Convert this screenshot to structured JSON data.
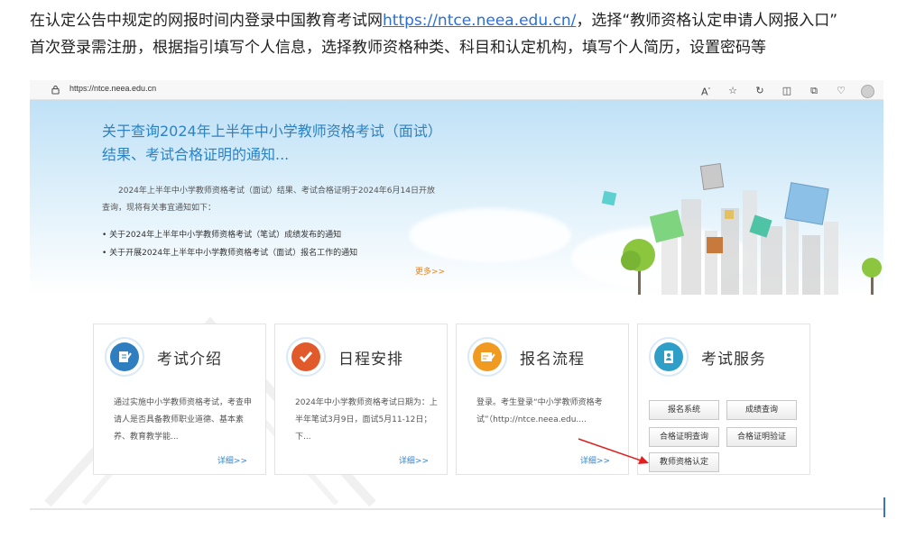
{
  "intro": {
    "line1_before": "在认定公告中规定的网报时间内登录中国教育考试网",
    "link": "https://ntce.neea.edu.cn/",
    "line1_after": "，选择“教师资格认定申请人网报入口”",
    "line2": "首次登录需注册，根据指引填写个人信息，选择教师资格种类、科目和认定机构，填写个人简历，设置密码等"
  },
  "browser": {
    "url": "https://ntce.neea.edu.cn",
    "icons": [
      "read-aloud-icon",
      "favorite-star-icon",
      "refresh-icon",
      "split-screen-icon",
      "collections-icon",
      "extensions-icon",
      "profile-avatar-icon"
    ]
  },
  "banner": {
    "news_title": "关于查询2024年上半年中小学教师资格考试（面试）结果、考试合格证明的通知...",
    "news_desc": "2024年上半年中小学教师资格考试（面试）结果、考试合格证明于2024年6月14日开放查询，现将有关事宜通知如下：",
    "news_items": [
      "关于2024年上半年中小学教师资格考试（笔试）成绩发布的通知",
      "关于开展2024年上半年中小学教师资格考试（面试）报名工作的通知"
    ],
    "more": "更多>>"
  },
  "cards": [
    {
      "title": "考试介绍",
      "desc": "通过实施中小学教师资格考试，考查申请人是否具备教师职业道德、基本素养、教育教学能...",
      "details": "详细>>",
      "color": "#2f7fc0"
    },
    {
      "title": "日程安排",
      "desc": "2024年中小学教师资格考试日期为：上半年笔试3月9日，面试5月11-12日；下...",
      "details": "详细>>",
      "color": "#e05a2b"
    },
    {
      "title": "报名流程",
      "desc": "登录。考生登录“中小学教师资格考试”（http://ntce.neea.edu....",
      "details": "详细>>",
      "color": "#f09a22"
    },
    {
      "title": "考试服务",
      "color": "#2f9fc8"
    }
  ],
  "services": {
    "buttons": [
      "报名系统",
      "成绩查询",
      "合格证明查询",
      "合格证明验证",
      "教师资格认定"
    ]
  },
  "colors": {
    "accent": "#2b83c6",
    "link": "#2a6fd6",
    "more": "#e8841e",
    "arrow": "#e02020"
  }
}
